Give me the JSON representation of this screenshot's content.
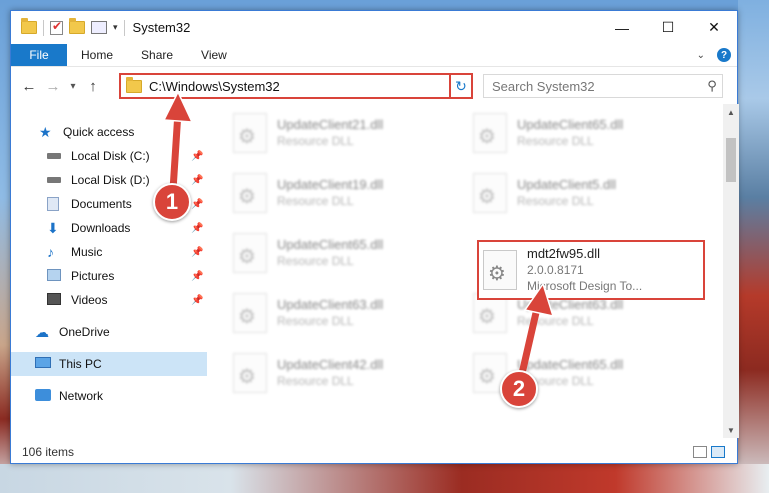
{
  "window": {
    "title": "System32",
    "controls": {
      "minimize": "—",
      "maximize": "☐",
      "close": "✕"
    }
  },
  "ribbon": {
    "tabs": [
      "File",
      "Home",
      "Share",
      "View"
    ]
  },
  "address": {
    "path": "C:\\Windows\\System32",
    "search_placeholder": "Search System32"
  },
  "sidebar": {
    "items": [
      {
        "label": "Quick access",
        "icon": "quick-access-star-icon",
        "pinned": false
      },
      {
        "label": "Local Disk (C:)",
        "icon": "drive-icon",
        "pinned": true
      },
      {
        "label": "Local Disk (D:)",
        "icon": "drive-icon",
        "pinned": true
      },
      {
        "label": "Documents",
        "icon": "documents-icon",
        "pinned": true
      },
      {
        "label": "Downloads",
        "icon": "downloads-icon",
        "pinned": true
      },
      {
        "label": "Music",
        "icon": "music-icon",
        "pinned": true
      },
      {
        "label": "Pictures",
        "icon": "pictures-icon",
        "pinned": true
      },
      {
        "label": "Videos",
        "icon": "videos-icon",
        "pinned": true
      },
      {
        "label": "OneDrive",
        "icon": "onedrive-icon",
        "pinned": false
      },
      {
        "label": "This PC",
        "icon": "this-pc-icon",
        "pinned": false,
        "selected": true
      },
      {
        "label": "Network",
        "icon": "network-icon",
        "pinned": false
      }
    ]
  },
  "files": {
    "left_column": [
      {
        "name": "UpdateClient21.dll",
        "sub": "Resource DLL"
      },
      {
        "name": "UpdateClient19.dll",
        "sub": "Resource DLL"
      },
      {
        "name": "UpdateClient65.dll",
        "sub": "Resource DLL"
      },
      {
        "name": "UpdateClient63.dll",
        "sub": "Resource DLL"
      },
      {
        "name": "UpdateClient42.dll",
        "sub": "Resource DLL"
      }
    ],
    "right_column": [
      {
        "name": "UpdateClient65.dll",
        "sub": "Resource DLL"
      },
      {
        "name": "UpdateClient5.dll",
        "sub": "Resource DLL"
      },
      {
        "name": "UpdateClient63.dll",
        "sub": "Resource DLL"
      },
      {
        "name": "UpdateClient65.dll",
        "sub": "Resource DLL"
      }
    ],
    "highlighted": {
      "name": "mdt2fw95.dll",
      "version": "2.0.0.8171",
      "description": "Microsoft Design To..."
    }
  },
  "status": {
    "item_count": "106 items"
  },
  "annotations": {
    "step1": "1",
    "step2": "2",
    "accent": "#d9443a"
  }
}
